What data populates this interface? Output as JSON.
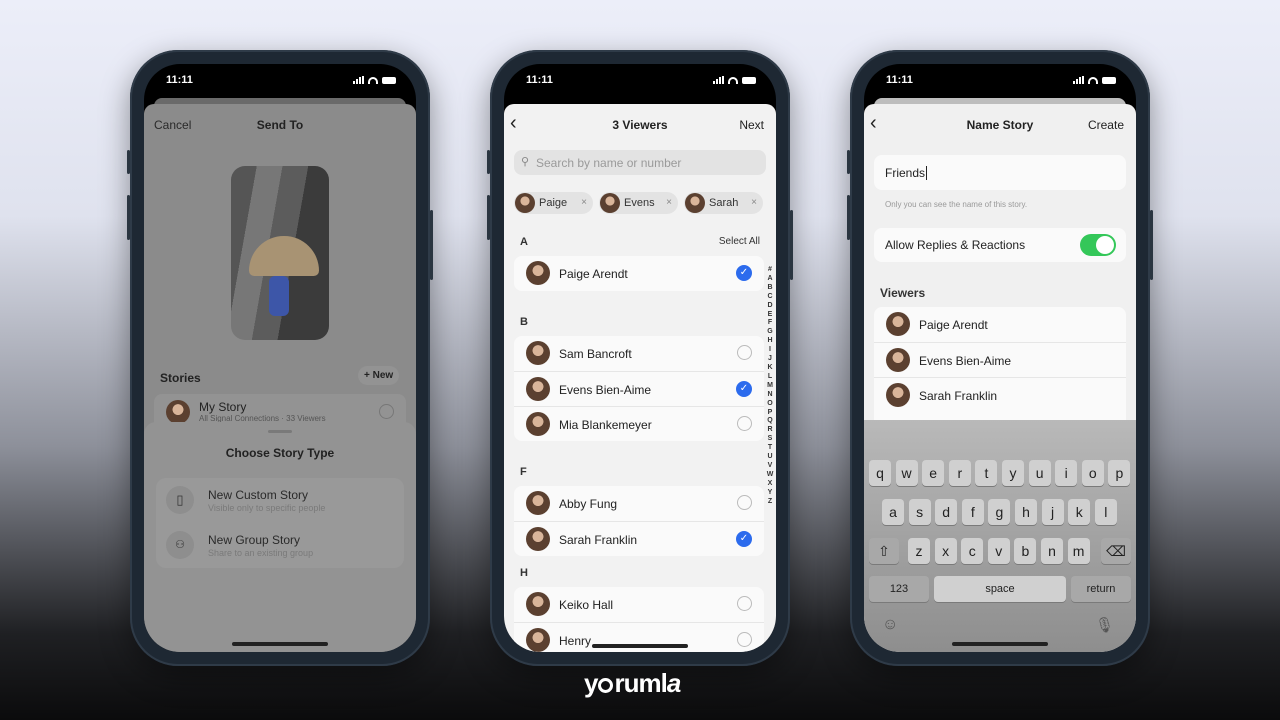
{
  "status_time": "11:11",
  "phone1": {
    "cancel": "Cancel",
    "title": "Send To",
    "stories_label": "Stories",
    "new_label": "+ New",
    "my_story": {
      "name": "My Story",
      "subtitle": "All Signal Connections · 33 Viewers"
    },
    "sheet": {
      "title": "Choose Story Type",
      "options": [
        {
          "title": "New Custom Story",
          "subtitle": "Visible only to specific people",
          "icon": "phone-icon"
        },
        {
          "title": "New Group Story",
          "subtitle": "Share to an existing group",
          "icon": "group-icon"
        }
      ]
    }
  },
  "phone2": {
    "back": "‹",
    "title": "3 Viewers",
    "next": "Next",
    "search_placeholder": "Search by name or number",
    "chips": [
      "Paige",
      "Evens",
      "Sarah"
    ],
    "select_all": "Select All",
    "sections": [
      {
        "letter": "A",
        "rows": [
          {
            "name": "Paige Arendt",
            "checked": true
          }
        ]
      },
      {
        "letter": "B",
        "rows": [
          {
            "name": "Sam Bancroft",
            "checked": false
          },
          {
            "name": "Evens Bien-Aime",
            "checked": true
          },
          {
            "name": "Mia Blankemeyer",
            "checked": false
          }
        ]
      },
      {
        "letter": "F",
        "rows": [
          {
            "name": "Abby Fung",
            "checked": false
          },
          {
            "name": "Sarah Franklin",
            "checked": true
          }
        ]
      },
      {
        "letter": "H",
        "rows": [
          {
            "name": "Keiko Hall",
            "checked": false
          },
          {
            "name": "Henry",
            "checked": false
          }
        ]
      }
    ],
    "index": [
      "#",
      "A",
      "B",
      "C",
      "D",
      "E",
      "F",
      "G",
      "H",
      "I",
      "J",
      "K",
      "L",
      "M",
      "N",
      "O",
      "P",
      "Q",
      "R",
      "S",
      "T",
      "U",
      "V",
      "W",
      "X",
      "Y",
      "Z"
    ]
  },
  "phone3": {
    "back": "‹",
    "title": "Name Story",
    "create": "Create",
    "name_value": "Friends",
    "hint": "Only you can see the name of this story.",
    "toggle_label": "Allow Replies & Reactions",
    "toggle_on": true,
    "viewers_label": "Viewers",
    "viewers": [
      "Paige Arendt",
      "Evens Bien-Aime",
      "Sarah Franklin"
    ],
    "keyboard": {
      "row1": [
        "q",
        "w",
        "e",
        "r",
        "t",
        "y",
        "u",
        "i",
        "o",
        "p"
      ],
      "row2": [
        "a",
        "s",
        "d",
        "f",
        "g",
        "h",
        "j",
        "k",
        "l"
      ],
      "row3": [
        "z",
        "x",
        "c",
        "v",
        "b",
        "n",
        "m"
      ],
      "numbers": "123",
      "space": "space",
      "return": "return"
    }
  },
  "colors": {
    "accent": "#2c6bed",
    "toggle": "#34c759"
  },
  "brand": "yorumla"
}
